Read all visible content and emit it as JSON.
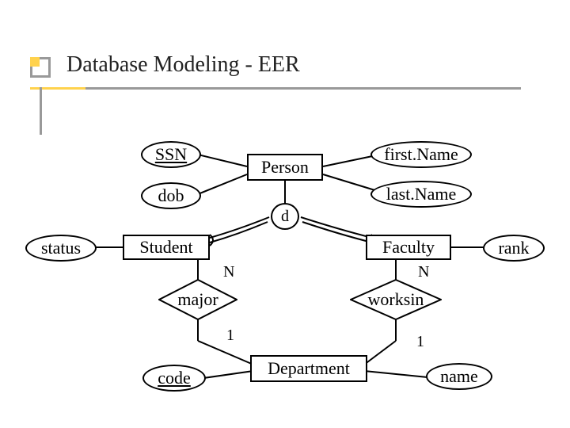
{
  "title": "Database Modeling - EER",
  "entities": {
    "person": "Person",
    "student": "Student",
    "faculty": "Faculty",
    "department": "Department"
  },
  "attributes": {
    "ssn": "SSN",
    "dob": "dob",
    "firstName": "first.Name",
    "lastName": "last.Name",
    "status": "status",
    "rank": "rank",
    "code": "code",
    "name": "name"
  },
  "relationships": {
    "major": "major",
    "worksin": "worksin"
  },
  "specialization_label": "d",
  "cardinalities": {
    "major_student": "N",
    "major_department": "1",
    "worksin_faculty": "N",
    "worksin_department": "1"
  }
}
